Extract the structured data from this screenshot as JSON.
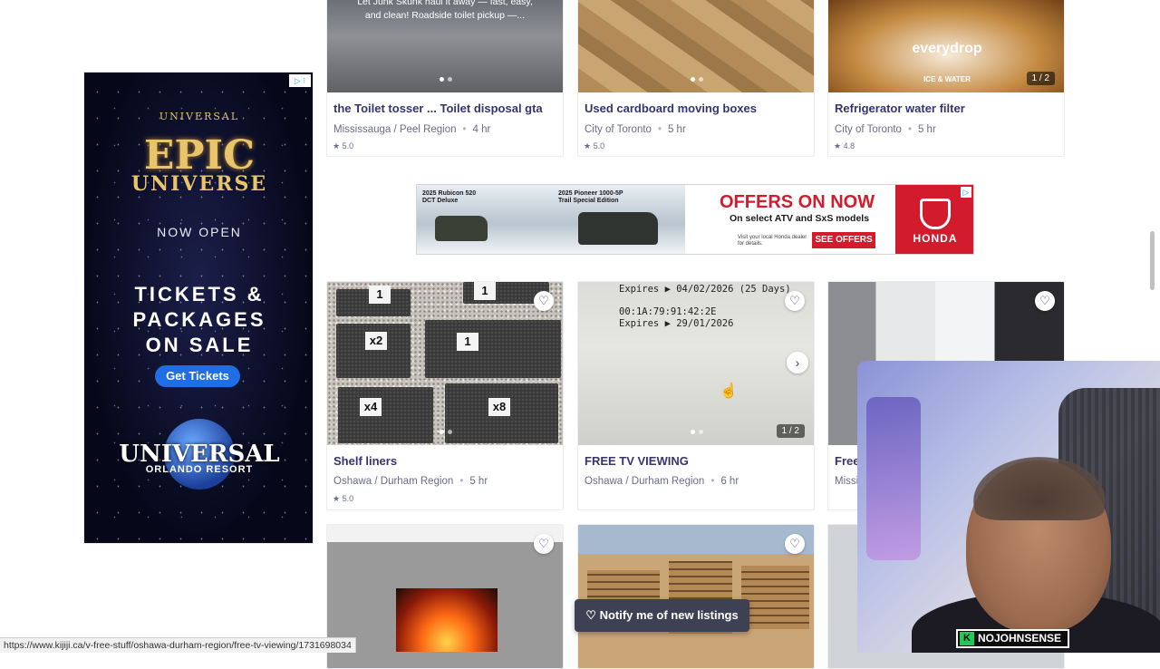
{
  "sky_ad": {
    "adchoices": "▷ ⁝",
    "universal_small": "UNIVERSAL",
    "epic": "EPIC",
    "universe": "UNIVERSE",
    "now_open": "NOW OPEN",
    "tickets_line1": "TICKETS &",
    "tickets_line2": "PACKAGES",
    "tickets_line3": "ON SALE",
    "cta": "Get Tickets",
    "resort_line1": "UNIVERSAL",
    "resort_line2": "ORLANDO RESORT"
  },
  "row1": [
    {
      "image_caption": "Let Junk Skunk haul it away — fast, easy, and clean! Roadside toilet pickup —...",
      "title": "the Toilet tosser ... Toilet disposal gta",
      "location": "Mississauga / Peel Region",
      "time": "4 hr",
      "rating": "5.0"
    },
    {
      "title": "Used cardboard moving boxes",
      "location": "City of Toronto",
      "time": "5 hr",
      "rating": "5.0"
    },
    {
      "brand_text": "everydrop",
      "brand_sub": "ICE & WATER",
      "counter": "1 / 2",
      "title": "Refrigerator water filter",
      "location": "City of Toronto",
      "time": "5 hr",
      "rating": "4.8"
    }
  ],
  "banner_ad": {
    "cap1": "2025 Rubicon 520 DCT Deluxe",
    "cap2": "2025 Pioneer 1000-5P Trail Special Edition",
    "headline": "OFFERS ON NOW",
    "subline": "On select ATV and SxS models",
    "visit": "Visit your local Honda dealer for details.",
    "cta": "SEE OFFERS",
    "brand": "HONDA"
  },
  "row2": [
    {
      "labels": [
        "1",
        "1",
        "x2",
        "1",
        "x4",
        "x8"
      ],
      "title": "Shelf liners",
      "location": "Oshawa / Durham Region",
      "time": "5 hr",
      "rating": "5.0"
    },
    {
      "screen_line1": "Expires ▶ 04/02/2026 (25 Days)",
      "screen_line2": "00:1A:79:91:42:2E",
      "screen_line3": "Expires ▶ 29/01/2026",
      "counter": "1 / 2",
      "title": "FREE TV VIEWING",
      "location": "Oshawa / Durham Region",
      "time": "6 hr"
    },
    {
      "title": "Free",
      "location": "Missi"
    }
  ],
  "notify_label": "Notify me of new listings",
  "status_url": "https://www.kijiji.ca/v-free-stuff/oshawa-durham-region/free-tv-viewing/1731698034",
  "streamer_tag": "NOJOHNSENSE",
  "heart_glyph": "♡",
  "star_glyph": "★",
  "next_glyph": "›",
  "cursor_glyph": "☝"
}
